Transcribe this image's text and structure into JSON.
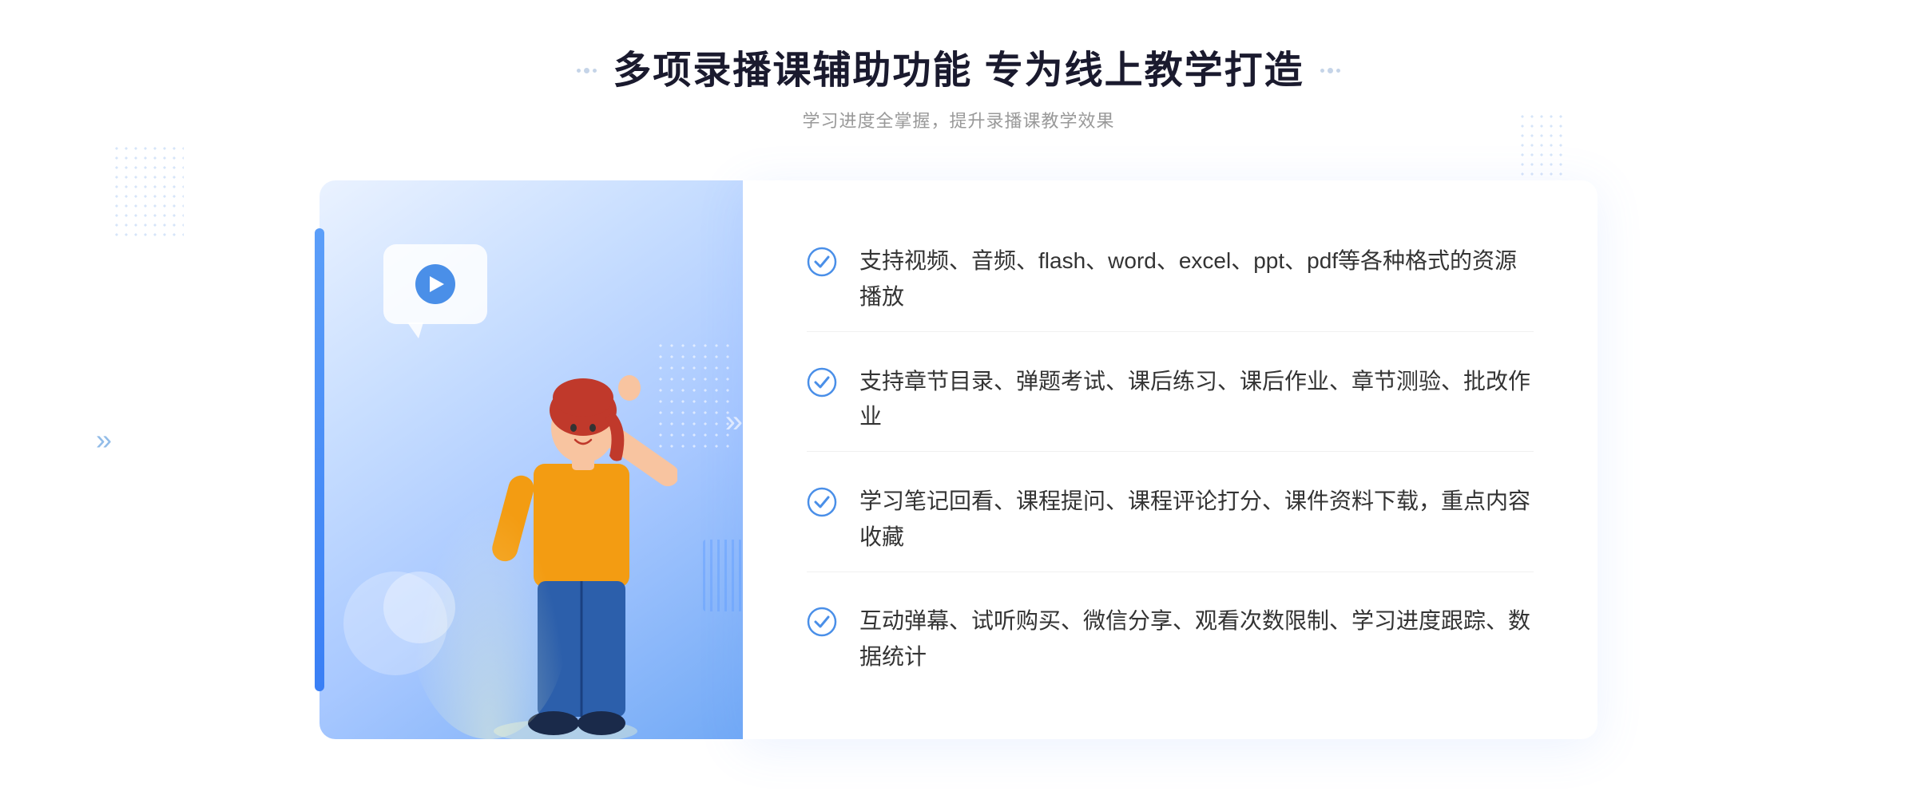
{
  "header": {
    "title": "多项录播课辅助功能 专为线上教学打造",
    "subtitle": "学习进度全掌握，提升录播课教学效果",
    "decorator_left": "decorators",
    "decorator_right": "decorators"
  },
  "features": [
    {
      "id": 1,
      "text": "支持视频、音频、flash、word、excel、ppt、pdf等各种格式的资源播放"
    },
    {
      "id": 2,
      "text": "支持章节目录、弹题考试、课后练习、课后作业、章节测验、批改作业"
    },
    {
      "id": 3,
      "text": "学习笔记回看、课程提问、课程评论打分、课件资料下载，重点内容收藏"
    },
    {
      "id": 4,
      "text": "互动弹幕、试听购买、微信分享、观看次数限制、学习进度跟踪、数据统计"
    }
  ],
  "colors": {
    "primary_blue": "#4a8fe8",
    "light_blue": "#6fa8f5",
    "check_color": "#4a8fe8",
    "title_color": "#1a1a2e",
    "text_color": "#333333",
    "subtitle_color": "#999999"
  },
  "icons": {
    "play": "▶",
    "chevron_double": "»",
    "check_circle": "check-circle"
  }
}
